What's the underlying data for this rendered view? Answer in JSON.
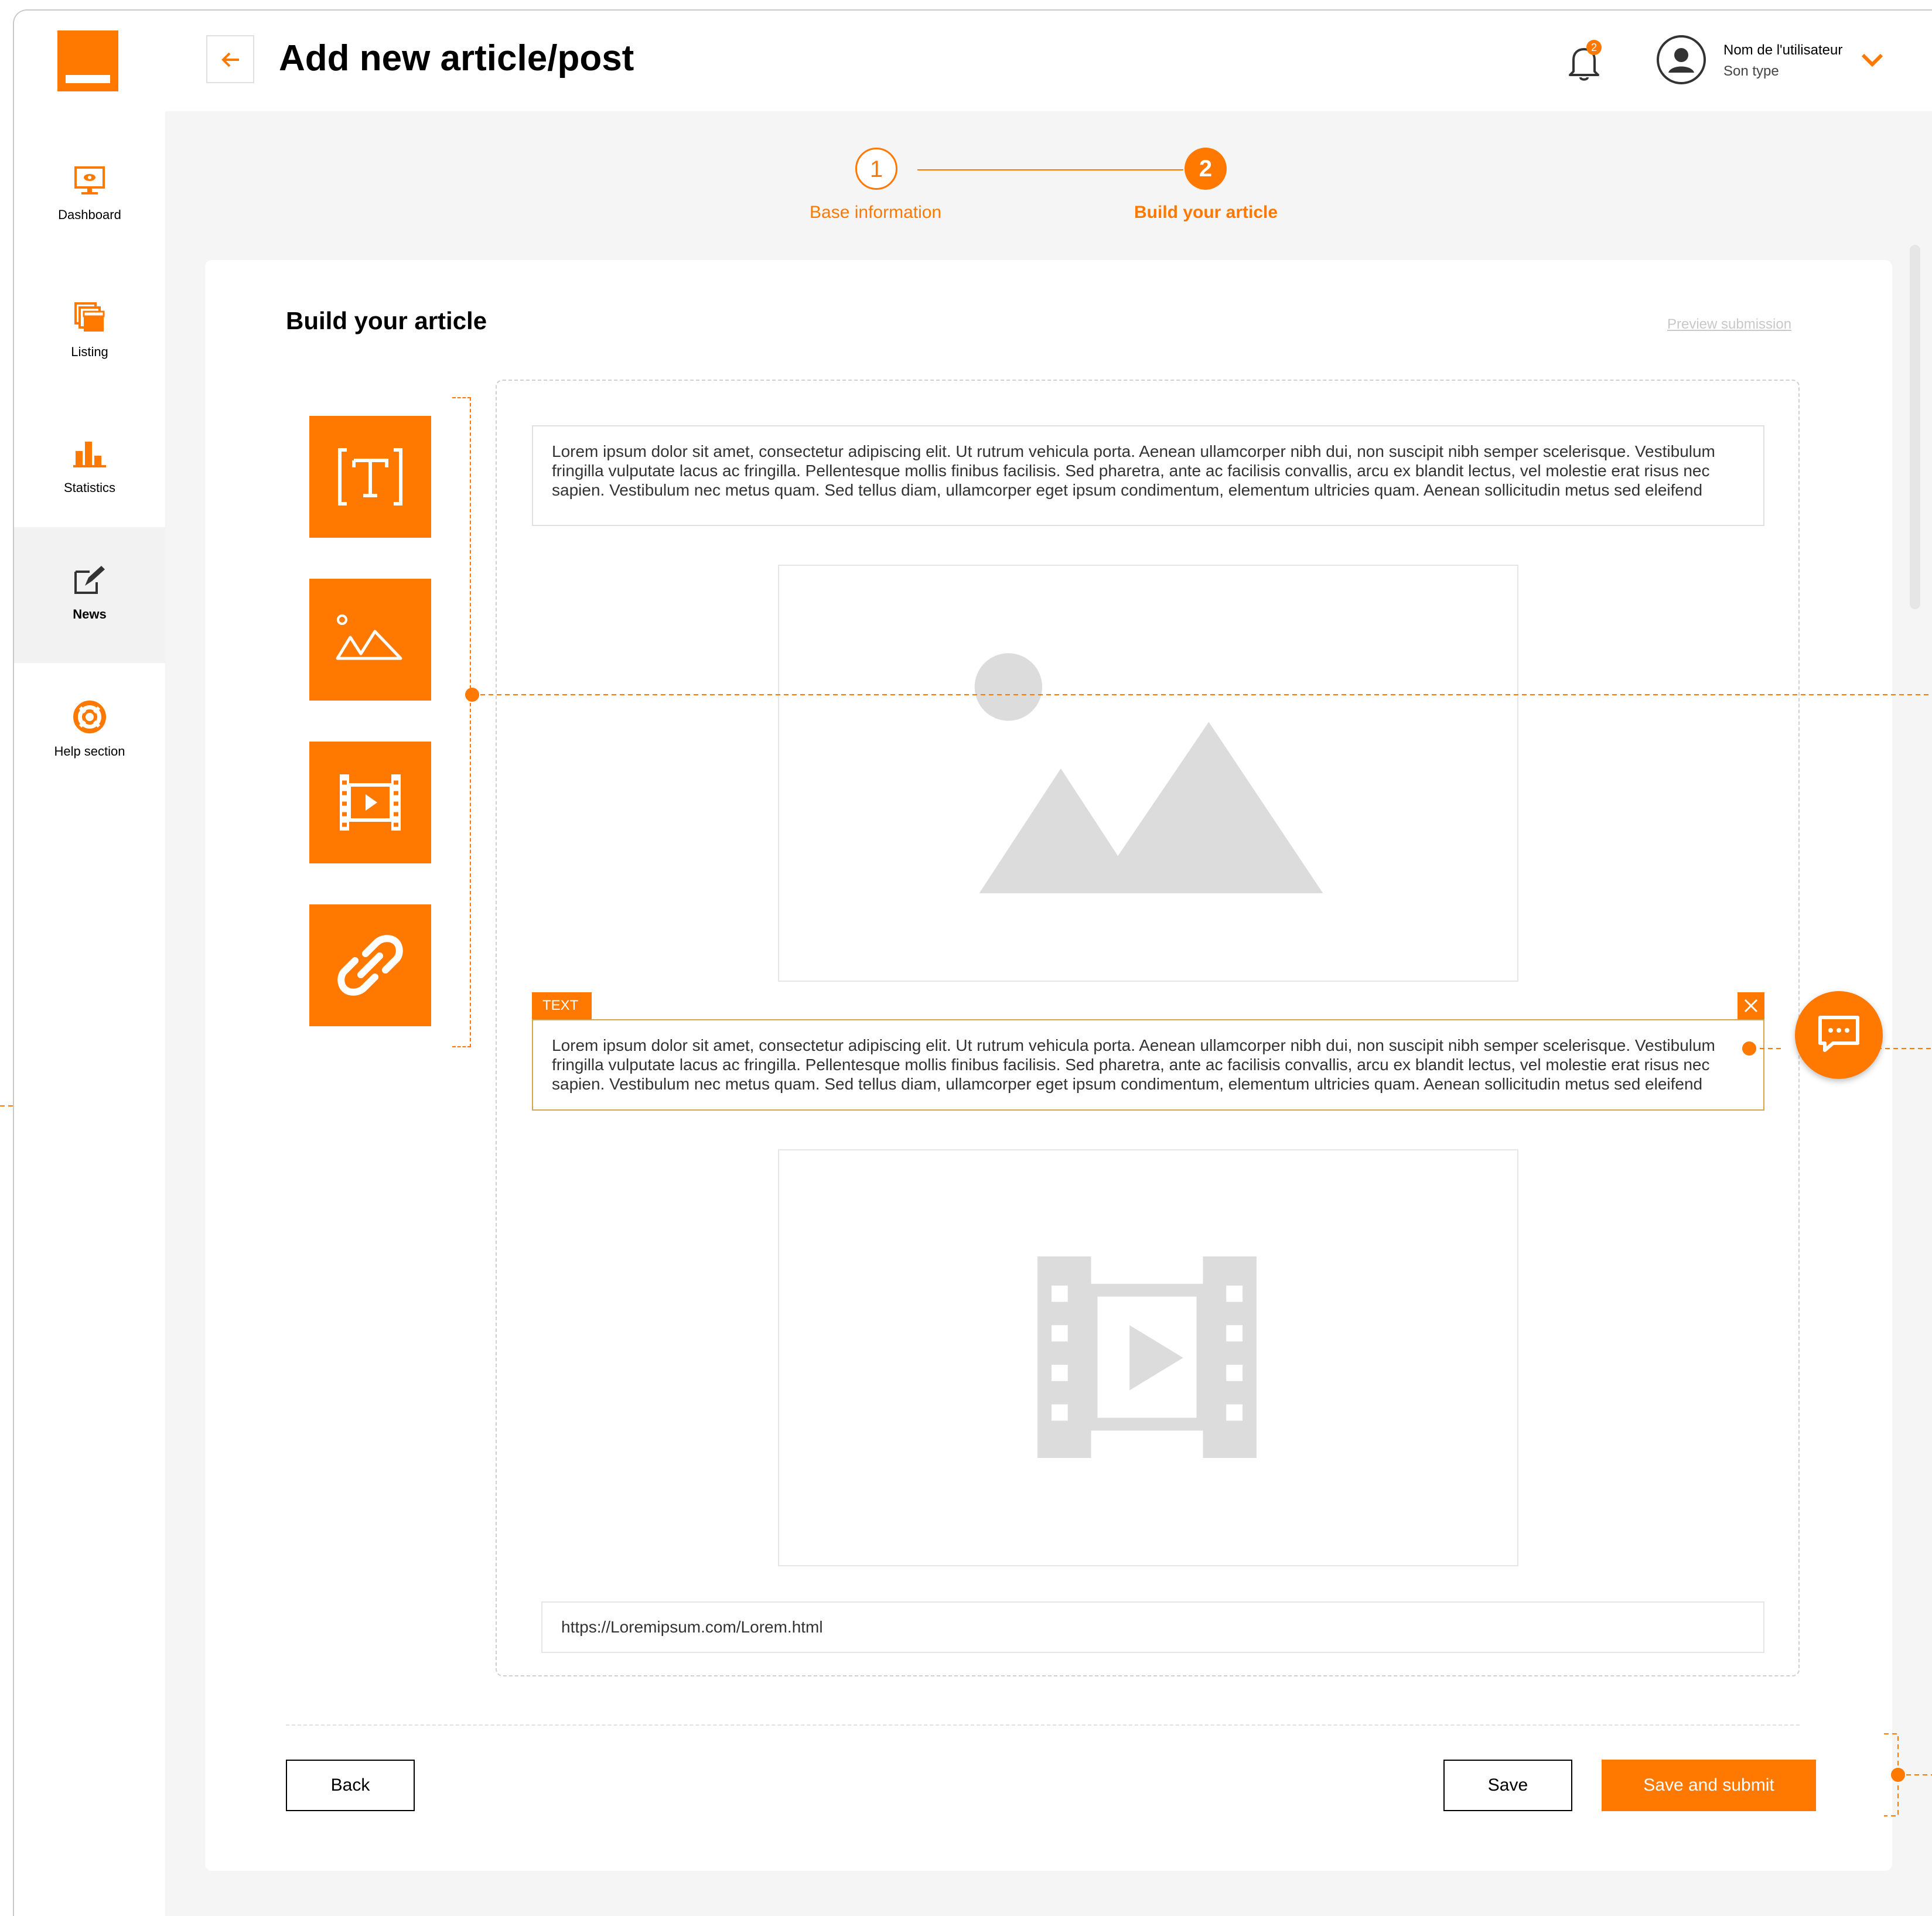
{
  "app": {
    "title": "Add new article/post",
    "accent_color": "#ff7900"
  },
  "sidebar": {
    "items": [
      {
        "label": "Dashboard",
        "icon": "monitor-eye-icon"
      },
      {
        "label": "Listing",
        "icon": "stacked-pages-icon"
      },
      {
        "label": "Statistics",
        "icon": "bar-chart-icon"
      },
      {
        "label": "News",
        "icon": "edit-note-icon",
        "active": true
      },
      {
        "label": "Help section",
        "icon": "lifebuoy-icon"
      }
    ]
  },
  "header": {
    "notification_count": "2",
    "user_name": "Nom de l'utilisateur",
    "user_type": "Son type"
  },
  "stepper": {
    "steps": [
      {
        "number": "1",
        "label": "Base information"
      },
      {
        "number": "2",
        "label": "Build your article",
        "active": true
      }
    ]
  },
  "card": {
    "title": "Build your article",
    "preview_link": "Preview submission"
  },
  "toolbox": [
    {
      "icon": "text-block-icon"
    },
    {
      "icon": "image-block-icon"
    },
    {
      "icon": "video-block-icon"
    },
    {
      "icon": "link-block-icon"
    }
  ],
  "blocks": {
    "text1": "Lorem ipsum dolor sit amet, consectetur adipiscing elit. Ut rutrum vehicula porta. Aenean ullamcorper nibh dui, non suscipit nibh semper scelerisque. Vestibulum fringilla vulputate lacus ac fringilla. Pellentesque mollis finibus facilisis. Sed pharetra, ante ac facilisis convallis, arcu ex blandit lectus, vel molestie erat risus nec sapien. Vestibulum nec metus quam. Sed tellus diam, ullamcorper eget ipsum condimentum, elementum ultricies quam. Aenean sollicitudin metus sed eleifend",
    "text2_tag": "TEXT",
    "text2": "Lorem ipsum dolor sit amet, consectetur adipiscing elit. Ut rutrum vehicula porta. Aenean ullamcorper nibh dui, non suscipit nibh semper scelerisque. Vestibulum fringilla vulputate lacus ac fringilla. Pellentesque mollis finibus facilisis. Sed pharetra, ante ac facilisis convallis, arcu ex blandit lectus, vel molestie erat risus nec sapien. Vestibulum nec metus quam. Sed tellus diam, ullamcorper eget ipsum condimentum, elementum ultricies quam. Aenean sollicitudin metus sed eleifend",
    "link_url": "https://Loremipsum.com/Lorem.html"
  },
  "actions": {
    "back": "Back",
    "save": "Save",
    "submit": "Save and submit"
  }
}
